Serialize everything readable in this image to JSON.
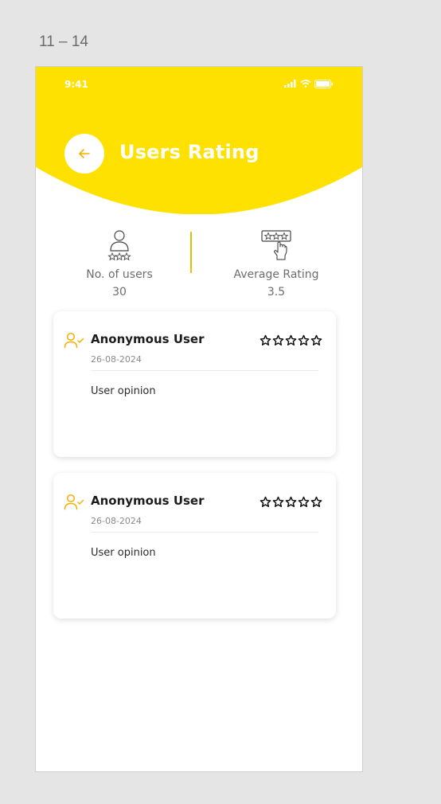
{
  "frame": {
    "label": "11 – 14"
  },
  "status_bar": {
    "time": "9:41",
    "icons": [
      "signal-icon",
      "wifi-icon",
      "battery-icon"
    ]
  },
  "header": {
    "title": "Users Rating",
    "back_icon": "arrow-left-icon",
    "accent_color": "#FFE100"
  },
  "stats": {
    "users": {
      "label": "No. of users",
      "value": "30",
      "icon": "user-stars-icon"
    },
    "average": {
      "label": "Average Rating",
      "value": "3.5",
      "icon": "hand-tap-stars-icon"
    }
  },
  "reviews": [
    {
      "name": "Anonymous User",
      "date": "26-08-2024",
      "opinion": "User opinion",
      "stars_filled": 0,
      "stars_total": 5
    },
    {
      "name": "Anonymous User",
      "date": "26-08-2024",
      "opinion": "User opinion",
      "stars_filled": 0,
      "stars_total": 5
    }
  ]
}
